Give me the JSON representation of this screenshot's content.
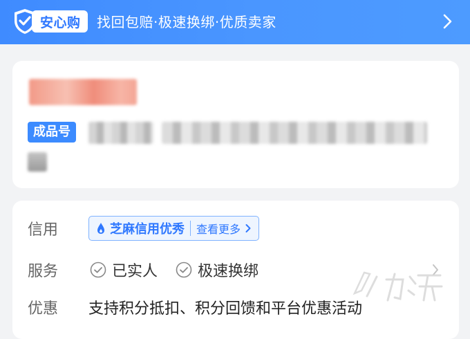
{
  "banner": {
    "badge_label": "安心购",
    "tagline": "找回包赔·极速换绑·优质卖家",
    "icons": {
      "shield": "shield-check-icon",
      "chevron": "chevron-right-icon"
    }
  },
  "product": {
    "id_label": "成品号"
  },
  "details": {
    "credit": {
      "label": "信用",
      "tag_text": "芝麻信用优秀",
      "more_text": "查看更多"
    },
    "service": {
      "label": "服务",
      "items": [
        "已实人",
        "极速换绑"
      ]
    },
    "discount": {
      "label": "优惠",
      "text": "支持积分抵扣、积分回馈和平台优惠活动"
    }
  },
  "colors": {
    "accent": "#2f78ff",
    "banner": "#4a96ff",
    "card": "#ffffff",
    "background": "#f2f3f5"
  }
}
